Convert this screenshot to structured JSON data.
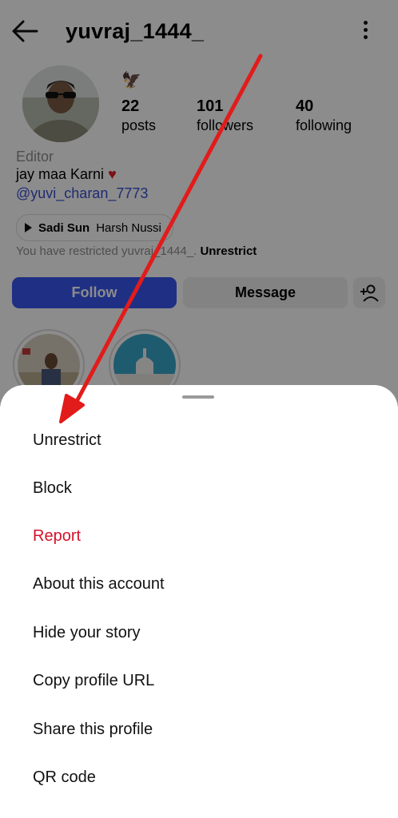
{
  "header": {
    "username": "yuvraj_1444_"
  },
  "profile": {
    "badge_emoji": "🦅",
    "stats": [
      {
        "value": "22",
        "label": "posts"
      },
      {
        "value": "101",
        "label": "followers"
      },
      {
        "value": "40",
        "label": "following"
      }
    ],
    "category": "Editor",
    "bio": "jay maa Karni",
    "bio_heart": "♥",
    "mention": "@yuvi_charan_7773",
    "music": {
      "title": "Sadi Sun",
      "artist": "Harsh Nussi"
    },
    "restricted_text": "You have restricted yuvraj_1444_.",
    "restricted_action": "Unrestrict"
  },
  "actions": {
    "follow": "Follow",
    "message": "Message"
  },
  "sheet": {
    "items": [
      {
        "label": "Unrestrict"
      },
      {
        "label": "Block"
      },
      {
        "label": "Report"
      },
      {
        "label": "About this account"
      },
      {
        "label": "Hide your story"
      },
      {
        "label": "Copy profile URL"
      },
      {
        "label": "Share this profile"
      },
      {
        "label": "QR code"
      }
    ]
  },
  "colors": {
    "follow_button": "#3a56f0",
    "report_text": "#d3122b",
    "annotation_arrow": "#e21b1b"
  }
}
